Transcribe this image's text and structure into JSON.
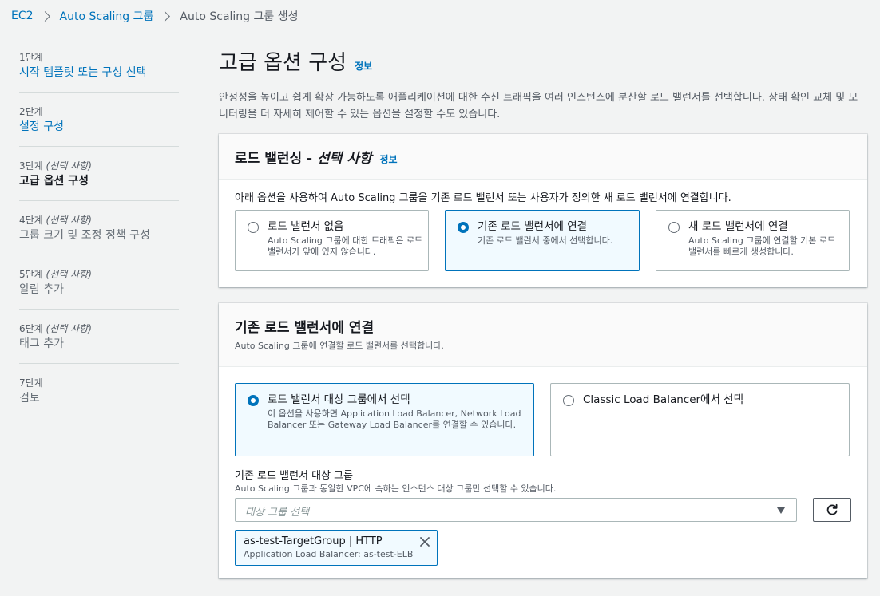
{
  "breadcrumb": [
    {
      "label": "EC2"
    },
    {
      "label": "Auto Scaling 그룹"
    },
    {
      "label": "Auto Scaling 그룹 생성"
    }
  ],
  "steps": [
    {
      "num": "1단계",
      "optional": "",
      "label": "시작 템플릿 또는 구성 선택"
    },
    {
      "num": "2단계",
      "optional": "",
      "label": "설정 구성"
    },
    {
      "num": "3단계",
      "optional": "(선택 사항)",
      "label": "고급 옵션 구성"
    },
    {
      "num": "4단계",
      "optional": "(선택 사항)",
      "label": "그룹 크기 및 조정 정책 구성"
    },
    {
      "num": "5단계",
      "optional": "(선택 사항)",
      "label": "알림 추가"
    },
    {
      "num": "6단계",
      "optional": "(선택 사항)",
      "label": "태그 추가"
    },
    {
      "num": "7단계",
      "optional": "",
      "label": "검토"
    }
  ],
  "page": {
    "title": "고급 옵션 구성",
    "info": "정보",
    "description": "안정성을 높이고 쉽게 확장 가능하도록 애플리케이션에 대한 수신 트래픽을 여러 인스턴스에 분산할 로드 밸런서를 선택합니다. 상태 확인 교체 및 모니터링을 더 자세히 제어할 수 있는 옵션을 설정할 수도 있습니다."
  },
  "lb_panel": {
    "title": "로드 밸런싱 -",
    "title_optional": "선택 사항",
    "info": "정보",
    "lead": "아래 옵션을 사용하여 Auto Scaling 그룹을 기존 로드 밸런서 또는 사용자가 정의한 새 로드 밸런서에 연결합니다.",
    "options": [
      {
        "title": "로드 밸런서 없음",
        "desc": "Auto Scaling 그룹에 대한 트래픽은 로드 밸런서가 앞에 있지 않습니다."
      },
      {
        "title": "기존 로드 밸런서에 연결",
        "desc": "기존 로드 밸런서 중에서 선택합니다."
      },
      {
        "title": "새 로드 밸런서에 연결",
        "desc": "Auto Scaling 그룹에 연결할 기본 로드 밸런서를 빠르게 생성합니다."
      }
    ],
    "selected": 1
  },
  "attach_panel": {
    "title": "기존 로드 밸런서에 연결",
    "subtitle": "Auto Scaling 그룹에 연결할 로드 밸런서를 선택합니다.",
    "options": [
      {
        "title": "로드 밸런서 대상 그룹에서 선택",
        "desc": "이 옵션을 사용하면 Application Load Balancer, Network Load Balancer 또는 Gateway Load Balancer를 연결할 수 있습니다."
      },
      {
        "title": "Classic Load Balancer에서 선택",
        "desc": ""
      }
    ],
    "selected": 0,
    "target_group_label": "기존 로드 밸런서 대상 그룹",
    "target_group_hint": "Auto Scaling 그룹과 동일한 VPC에 속하는 인스턴스 대상 그룹만 선택할 수 있습니다.",
    "select_placeholder": "대상 그룹 선택",
    "token": {
      "title": "as-test-TargetGroup | HTTP",
      "subtitle": "Application Load Balancer: as-test-ELB"
    }
  },
  "colors": {
    "link": "#0073bb",
    "selected_bg": "#f1faff",
    "page_bg": "#f2f3f3"
  },
  "icons": {
    "refresh": "refresh-icon",
    "close": "close-icon",
    "caret": "caret-down-icon"
  }
}
